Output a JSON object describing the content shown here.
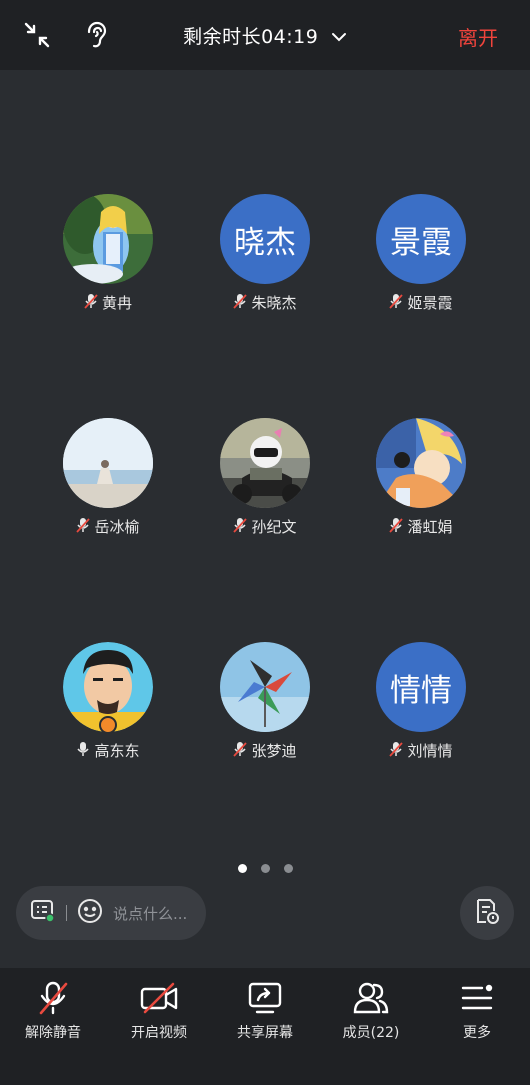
{
  "header": {
    "remaining_time_label": "剩余时长04:19",
    "leave_label": "离开",
    "leave_color": "#f0443c"
  },
  "participants": [
    {
      "name": "黄冉",
      "avatar_type": "photo",
      "avatar_desc": "alice-cartoon",
      "mic": "muted"
    },
    {
      "name": "朱晓杰",
      "avatar_type": "text",
      "avatar_text": "晓杰",
      "mic": "muted"
    },
    {
      "name": "姬景霞",
      "avatar_type": "text",
      "avatar_text": "景霞",
      "mic": "muted"
    },
    {
      "name": "岳冰榆",
      "avatar_type": "photo",
      "avatar_desc": "seaside-person",
      "mic": "muted"
    },
    {
      "name": "孙纪文",
      "avatar_type": "photo",
      "avatar_desc": "motorcycle-rider",
      "mic": "muted"
    },
    {
      "name": "潘虹娟",
      "avatar_type": "photo",
      "avatar_desc": "anime-girl-cat",
      "mic": "muted"
    },
    {
      "name": "高东东",
      "avatar_type": "photo",
      "avatar_desc": "cartoon-man",
      "mic": "on",
      "host": true
    },
    {
      "name": "张梦迪",
      "avatar_type": "photo",
      "avatar_desc": "pinwheel-sky",
      "mic": "muted"
    },
    {
      "name": "刘情情",
      "avatar_type": "text",
      "avatar_text": "情情",
      "mic": "muted"
    }
  ],
  "pager": {
    "pages": 3,
    "current": 1
  },
  "chat": {
    "placeholder": "说点什么..."
  },
  "toolbar": {
    "unmute_label": "解除静音",
    "video_label": "开启视频",
    "share_label": "共享屏幕",
    "members_label": "成员(22)",
    "more_label": "更多"
  },
  "colors": {
    "text_avatar_bg": "#3b6fc6",
    "muted_slash": "#e84a3f",
    "background": "#2a2d31",
    "bar_background": "#1f2124"
  }
}
